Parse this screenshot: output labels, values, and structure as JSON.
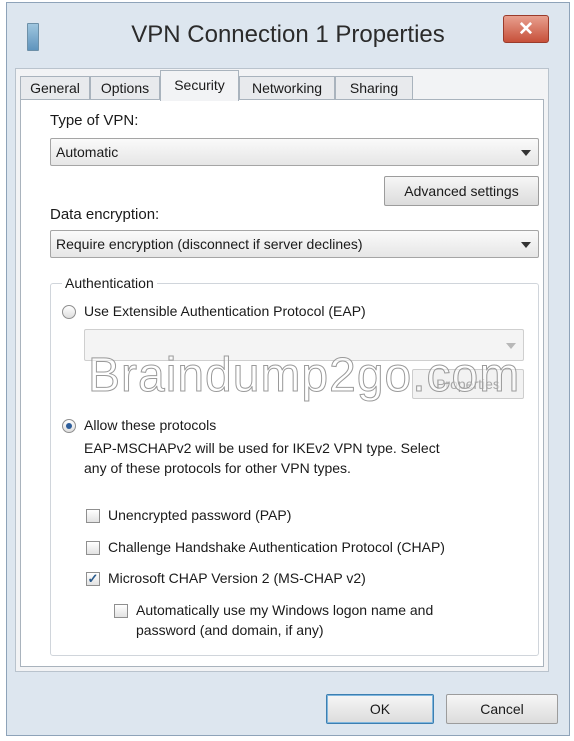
{
  "window": {
    "title": "VPN Connection 1 Properties",
    "close_label": "✕"
  },
  "tabs": [
    {
      "label": "General",
      "active": false
    },
    {
      "label": "Options",
      "active": false
    },
    {
      "label": "Security",
      "active": true
    },
    {
      "label": "Networking",
      "active": false
    },
    {
      "label": "Sharing",
      "active": false
    }
  ],
  "security": {
    "vpn_type_label": "Type of VPN:",
    "vpn_type_value": "Automatic",
    "advanced_settings_label": "Advanced settings",
    "data_encryption_label": "Data encryption:",
    "data_encryption_value": "Require encryption (disconnect if server declines)",
    "authentication": {
      "group_label": "Authentication",
      "eap_radio_label": "Use Extensible Authentication Protocol (EAP)",
      "eap_selected": false,
      "eap_method_value": "",
      "properties_label": "Properties",
      "allow_radio_label": "Allow these protocols",
      "allow_selected": true,
      "allow_note_line1": "EAP-MSCHAPv2 will be used for IKEv2 VPN type. Select",
      "allow_note_line2": "any of these protocols for other VPN types.",
      "protocols": [
        {
          "label": "Unencrypted password (PAP)",
          "checked": false
        },
        {
          "label": "Challenge Handshake Authentication Protocol (CHAP)",
          "checked": false
        },
        {
          "label": "Microsoft CHAP Version 2 (MS-CHAP v2)",
          "checked": true
        }
      ],
      "auto_logon_line1": "Automatically use my Windows logon name and",
      "auto_logon_line2": "password (and domain, if any)",
      "auto_logon_checked": false
    }
  },
  "footer": {
    "ok_label": "OK",
    "cancel_label": "Cancel"
  },
  "watermark": "Braindump2go.com",
  "colors": {
    "frame": "#dde6ef",
    "close_button": "#c7503a",
    "panel": "#ffffff"
  }
}
